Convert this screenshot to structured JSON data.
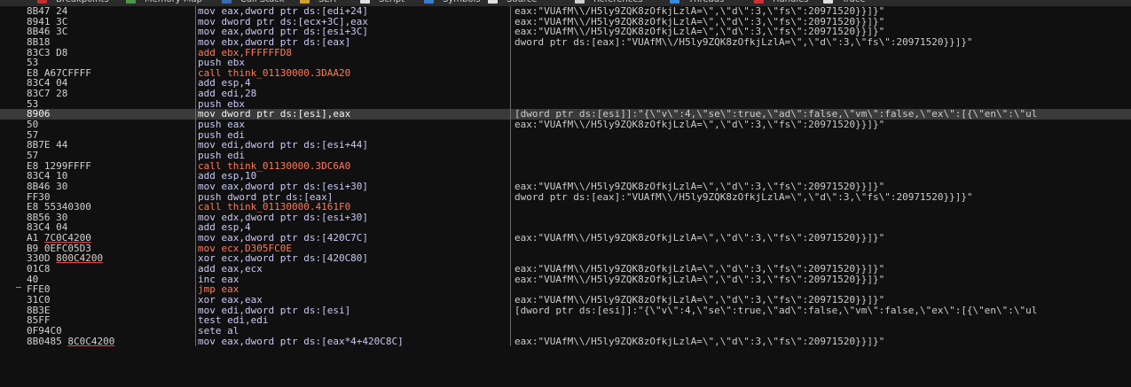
{
  "tabs": [
    {
      "label": "Breakpoints",
      "icon": "breakpoint-icon",
      "color": "#c03030"
    },
    {
      "label": "Memory Map",
      "icon": "memory-map-icon",
      "color": "#4a9a4a"
    },
    {
      "label": "Call Stack",
      "icon": "call-stack-icon",
      "color": "#3a6ab0"
    },
    {
      "label": "SEH",
      "icon": "seh-icon",
      "color": "#d0a030"
    },
    {
      "label": "Script",
      "icon": "script-icon",
      "color": "#e0e0e0"
    },
    {
      "label": "Symbols",
      "icon": "symbols-icon",
      "color": "#3a7ad0"
    },
    {
      "label": "Source",
      "icon": "source-icon",
      "color": "#e0e0e0"
    },
    {
      "label": "References",
      "icon": "references-icon",
      "color": "#d0d0d0"
    },
    {
      "label": "Threads",
      "icon": "threads-icon",
      "color": "#3a8ae0"
    },
    {
      "label": "Handles",
      "icon": "handles-icon",
      "color": "#d03030"
    },
    {
      "label": "Trace",
      "icon": "trace-icon",
      "color": "#e0e0e0"
    }
  ],
  "rows": [
    {
      "bytes": "8B47 24",
      "asm": "mov eax,dword ptr ds:[edi+24]",
      "kind": "normal",
      "comment": "eax:\"VUAfM\\\\/H5ly9ZQK8zOfkjLzlA=\\\",\\\"d\\\":3,\\\"fs\\\":20971520}}]}\""
    },
    {
      "bytes": "8941 3C",
      "asm": "mov dword ptr ds:[ecx+3C],eax",
      "kind": "normal",
      "comment": "eax:\"VUAfM\\\\/H5ly9ZQK8zOfkjLzlA=\\\",\\\"d\\\":3,\\\"fs\\\":20971520}}]}\""
    },
    {
      "bytes": "8B46 3C",
      "asm": "mov eax,dword ptr ds:[esi+3C]",
      "kind": "normal",
      "comment": "eax:\"VUAfM\\\\/H5ly9ZQK8zOfkjLzlA=\\\",\\\"d\\\":3,\\\"fs\\\":20971520}}]}\""
    },
    {
      "bytes": "8B18",
      "asm": "mov ebx,dword ptr ds:[eax]",
      "kind": "normal",
      "comment": "dword ptr ds:[eax]:\"VUAfM\\\\/H5ly9ZQK8zOfkjLzlA=\\\",\\\"d\\\":3,\\\"fs\\\":20971520}}]}\""
    },
    {
      "bytes": "83C3 D8",
      "asm": "add ebx,FFFFFFD8",
      "kind": "imm",
      "comment": ""
    },
    {
      "bytes": "53",
      "asm": "push ebx",
      "kind": "normal",
      "comment": ""
    },
    {
      "bytes": "E8 A67CFFFF",
      "asm": "call think_01130000.3DAA20",
      "kind": "call",
      "comment": ""
    },
    {
      "bytes": "83C4 04",
      "asm": "add esp,4",
      "kind": "normal",
      "comment": ""
    },
    {
      "bytes": "83C7 28",
      "asm": "add edi,28",
      "kind": "normal",
      "comment": ""
    },
    {
      "bytes": "53",
      "asm": "push ebx",
      "kind": "normal",
      "comment": ""
    },
    {
      "bytes": "8906",
      "asm": "mov dword ptr ds:[esi],eax",
      "kind": "current",
      "comment": "[dword ptr ds:[esi]]:\"{\\\"v\\\":4,\\\"se\\\":true,\\\"ad\\\":false,\\\"vm\\\":false,\\\"ex\\\":[{\\\"en\\\":\\\"ul"
    },
    {
      "bytes": "50",
      "asm": "push eax",
      "kind": "normal",
      "comment": "eax:\"VUAfM\\\\/H5ly9ZQK8zOfkjLzlA=\\\",\\\"d\\\":3,\\\"fs\\\":20971520}}]}\""
    },
    {
      "bytes": "57",
      "asm": "push edi",
      "kind": "normal",
      "comment": ""
    },
    {
      "bytes": "8B7E 44",
      "asm": "mov edi,dword ptr ds:[esi+44]",
      "kind": "normal",
      "comment": ""
    },
    {
      "bytes": "57",
      "asm": "push edi",
      "kind": "normal",
      "comment": ""
    },
    {
      "bytes": "E8 1299FFFF",
      "asm": "call think_01130000.3DC6A0",
      "kind": "call",
      "comment": ""
    },
    {
      "bytes": "83C4 10",
      "asm": "add esp,10",
      "kind": "normal",
      "comment": ""
    },
    {
      "bytes": "8B46 30",
      "asm": "mov eax,dword ptr ds:[esi+30]",
      "kind": "normal",
      "comment": "eax:\"VUAfM\\\\/H5ly9ZQK8zOfkjLzlA=\\\",\\\"d\\\":3,\\\"fs\\\":20971520}}]}\""
    },
    {
      "bytes": "FF30",
      "asm": "push dword ptr ds:[eax]",
      "kind": "normal",
      "comment": "dword ptr ds:[eax]:\"VUAfM\\\\/H5ly9ZQK8zOfkjLzlA=\\\",\\\"d\\\":3,\\\"fs\\\":20971520}}]}\""
    },
    {
      "bytes": "E8 55340300",
      "asm": "call think_01130000.4161F0",
      "kind": "call",
      "comment": ""
    },
    {
      "bytes": "8B56 30",
      "asm": "mov edx,dword ptr ds:[esi+30]",
      "kind": "normal",
      "comment": ""
    },
    {
      "bytes": "83C4 04",
      "asm": "add esp,4",
      "kind": "normal",
      "comment": ""
    },
    {
      "bytes": "A1 7C0C4200",
      "asm": "mov eax,dword ptr ds:[420C7C]",
      "kind": "normal",
      "comment": "eax:\"VUAfM\\\\/H5ly9ZQK8zOfkjLzlA=\\\",\\\"d\\\":3,\\\"fs\\\":20971520}}]}\"",
      "ul": "7C0C4200"
    },
    {
      "bytes": "B9 0EFC05D3",
      "asm": "mov ecx,D305FC0E",
      "kind": "imm",
      "comment": ""
    },
    {
      "bytes": "330D 800C4200",
      "asm": "xor ecx,dword ptr ds:[420C80]",
      "kind": "normal",
      "comment": "",
      "ul": "800C4200"
    },
    {
      "bytes": "01C8",
      "asm": "add eax,ecx",
      "kind": "normal",
      "comment": "eax:\"VUAfM\\\\/H5ly9ZQK8zOfkjLzlA=\\\",\\\"d\\\":3,\\\"fs\\\":20971520}}]}\""
    },
    {
      "bytes": "40",
      "asm": "inc eax",
      "kind": "normal",
      "comment": "eax:\"VUAfM\\\\/H5ly9ZQK8zOfkjLzlA=\\\",\\\"d\\\":3,\\\"fs\\\":20971520}}]}\""
    },
    {
      "bytes": "FFE0",
      "asm": "jmp eax",
      "kind": "jmp",
      "comment": ""
    },
    {
      "bytes": "31C0",
      "asm": "xor eax,eax",
      "kind": "normal",
      "comment": "eax:\"VUAfM\\\\/H5ly9ZQK8zOfkjLzlA=\\\",\\\"d\\\":3,\\\"fs\\\":20971520}}]}\""
    },
    {
      "bytes": "8B3E",
      "asm": "mov edi,dword ptr ds:[esi]",
      "kind": "normal",
      "comment": "[dword ptr ds:[esi]]:\"{\\\"v\\\":4,\\\"se\\\":true,\\\"ad\\\":false,\\\"vm\\\":false,\\\"ex\\\":[{\\\"en\\\":\\\"ul"
    },
    {
      "bytes": "85FF",
      "asm": "test edi,edi",
      "kind": "normal",
      "comment": ""
    },
    {
      "bytes": "0F94C0",
      "asm": "sete al",
      "kind": "normal",
      "comment": ""
    },
    {
      "bytes": "8B0485 8C0C4200",
      "asm": "mov eax,dword ptr ds:[eax*4+420C8C]",
      "kind": "normal",
      "comment": "eax:\"VUAfM\\\\/H5ly9ZQK8zOfkjLzlA=\\\",\\\"d\\\":3,\\\"fs\\\":20971520}}]}\"",
      "ul": "8C0C4200"
    }
  ],
  "colors": {
    "background": "#101010",
    "current_row": "#3a3a3a",
    "call_jmp": "#ff7a5c",
    "imm": "#ff7a5c",
    "mnemonic": "#c9c9f5"
  }
}
